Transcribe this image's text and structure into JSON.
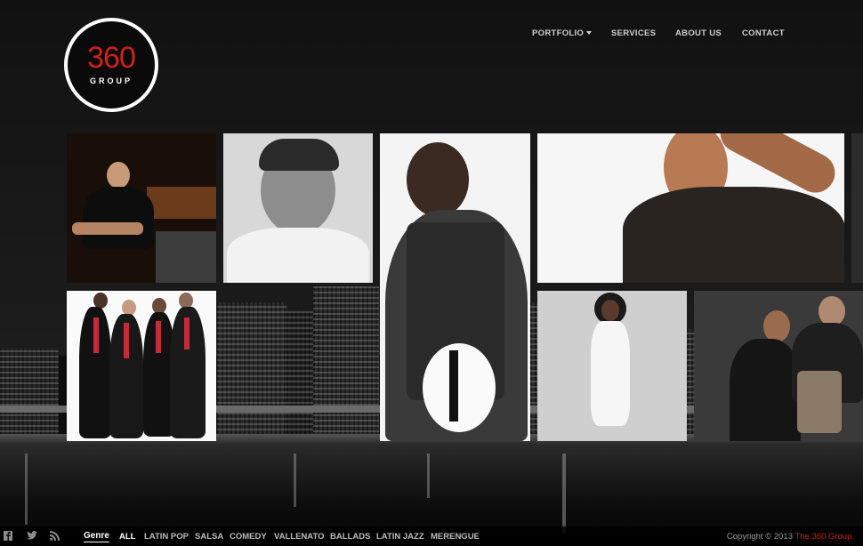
{
  "logo": {
    "number": "360",
    "word": "GROUP"
  },
  "nav": [
    {
      "label": "PORTFOLIO",
      "has_dropdown": true
    },
    {
      "label": "SERVICES"
    },
    {
      "label": "ABOUT US"
    },
    {
      "label": "CONTACT"
    }
  ],
  "footer": {
    "social": [
      "facebook-icon",
      "twitter-icon",
      "rss-icon"
    ],
    "genre_label": "Genre",
    "filters": [
      "ALL",
      "LATIN POP",
      "SALSA",
      "COMEDY",
      "VALLENATO",
      "BALLADS",
      "LATIN JAZZ",
      "MERENGUE"
    ],
    "active_filter": "ALL",
    "copyright": "Copyright © 2013 ",
    "brand": "The 360 Group."
  },
  "colors": {
    "accent": "#d0201c",
    "background": "#0e0e0e"
  }
}
